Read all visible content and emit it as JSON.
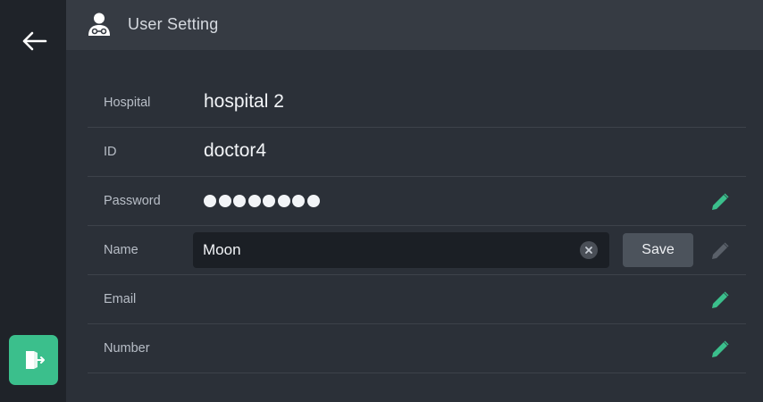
{
  "header": {
    "title": "User Setting",
    "icon": "user-doctor-icon"
  },
  "nav": {
    "back_icon": "arrow-left-icon",
    "logout_icon": "logout-door-icon"
  },
  "colors": {
    "accent": "#3bbf8c",
    "background": "#2b3038",
    "header_bg": "#363b43",
    "rail_bg": "#1f2329"
  },
  "fields": {
    "hospital": {
      "label": "Hospital",
      "value": "hospital 2"
    },
    "id": {
      "label": "ID",
      "value": "doctor4"
    },
    "password": {
      "label": "Password",
      "value": "●●●●●●●●",
      "edit_icon": "pencil-icon"
    },
    "name": {
      "label": "Name",
      "value": "Moon",
      "save_label": "Save",
      "clear_icon": "clear-icon",
      "edit_icon": "pencil-icon"
    },
    "email": {
      "label": "Email",
      "value": "",
      "edit_icon": "pencil-icon"
    },
    "number": {
      "label": "Number",
      "value": "",
      "edit_icon": "pencil-icon"
    }
  }
}
